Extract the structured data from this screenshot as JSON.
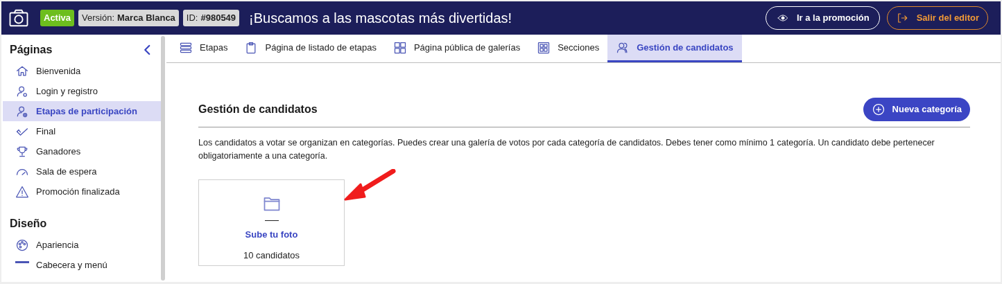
{
  "header": {
    "status_badge": "Activa",
    "version_label": "Versión:",
    "version_value": "Marca Blanca",
    "id_label": "ID:",
    "id_value": "#980549",
    "title": "¡Buscamos a las mascotas más divertidas!",
    "buttons": [
      {
        "kind": "view",
        "label": "Ir a la promoción"
      },
      {
        "kind": "exit",
        "label": "Salir del editor"
      }
    ]
  },
  "sidebar": {
    "sections": [
      {
        "title": "Páginas",
        "items": [
          {
            "kind": "home",
            "label": "Bienvenida",
            "selected": false
          },
          {
            "kind": "user-gear",
            "label": "Login y registro",
            "selected": false
          },
          {
            "kind": "user-plus",
            "label": "Etapas de participación",
            "selected": true
          },
          {
            "kind": "check",
            "label": "Final",
            "selected": false
          },
          {
            "kind": "trophy",
            "label": "Ganadores",
            "selected": false
          },
          {
            "kind": "gauge",
            "label": "Sala de espera",
            "selected": false
          },
          {
            "kind": "warning",
            "label": "Promoción finalizada",
            "selected": false
          }
        ]
      },
      {
        "title": "Diseño",
        "items": [
          {
            "kind": "palette",
            "label": "Apariencia",
            "selected": false
          },
          {
            "kind": "bar",
            "label": "Cabecera y menú",
            "selected": false
          }
        ]
      }
    ]
  },
  "tabs": [
    {
      "kind": "list",
      "label": "Etapas",
      "selected": false
    },
    {
      "kind": "clipboard",
      "label": "Página de listado de etapas",
      "selected": false
    },
    {
      "kind": "grid",
      "label": "Página pública de galerías",
      "selected": false
    },
    {
      "kind": "sections",
      "label": "Secciones",
      "selected": false
    },
    {
      "kind": "people",
      "label": "Gestión de candidatos",
      "selected": true
    }
  ],
  "content": {
    "title": "Gestión de candidatos",
    "new_button": "Nueva categoría",
    "description": "Los candidatos a votar se organizan en categorías. Puedes crear una galería de votos por cada categoría de candidatos. Debes tener como mínimo 1 categoría. Un candidato debe pertenecer obligatoriamente a una categoría.",
    "categories": [
      {
        "name": "Sube tu foto",
        "count": "10 candidatos"
      }
    ]
  }
}
